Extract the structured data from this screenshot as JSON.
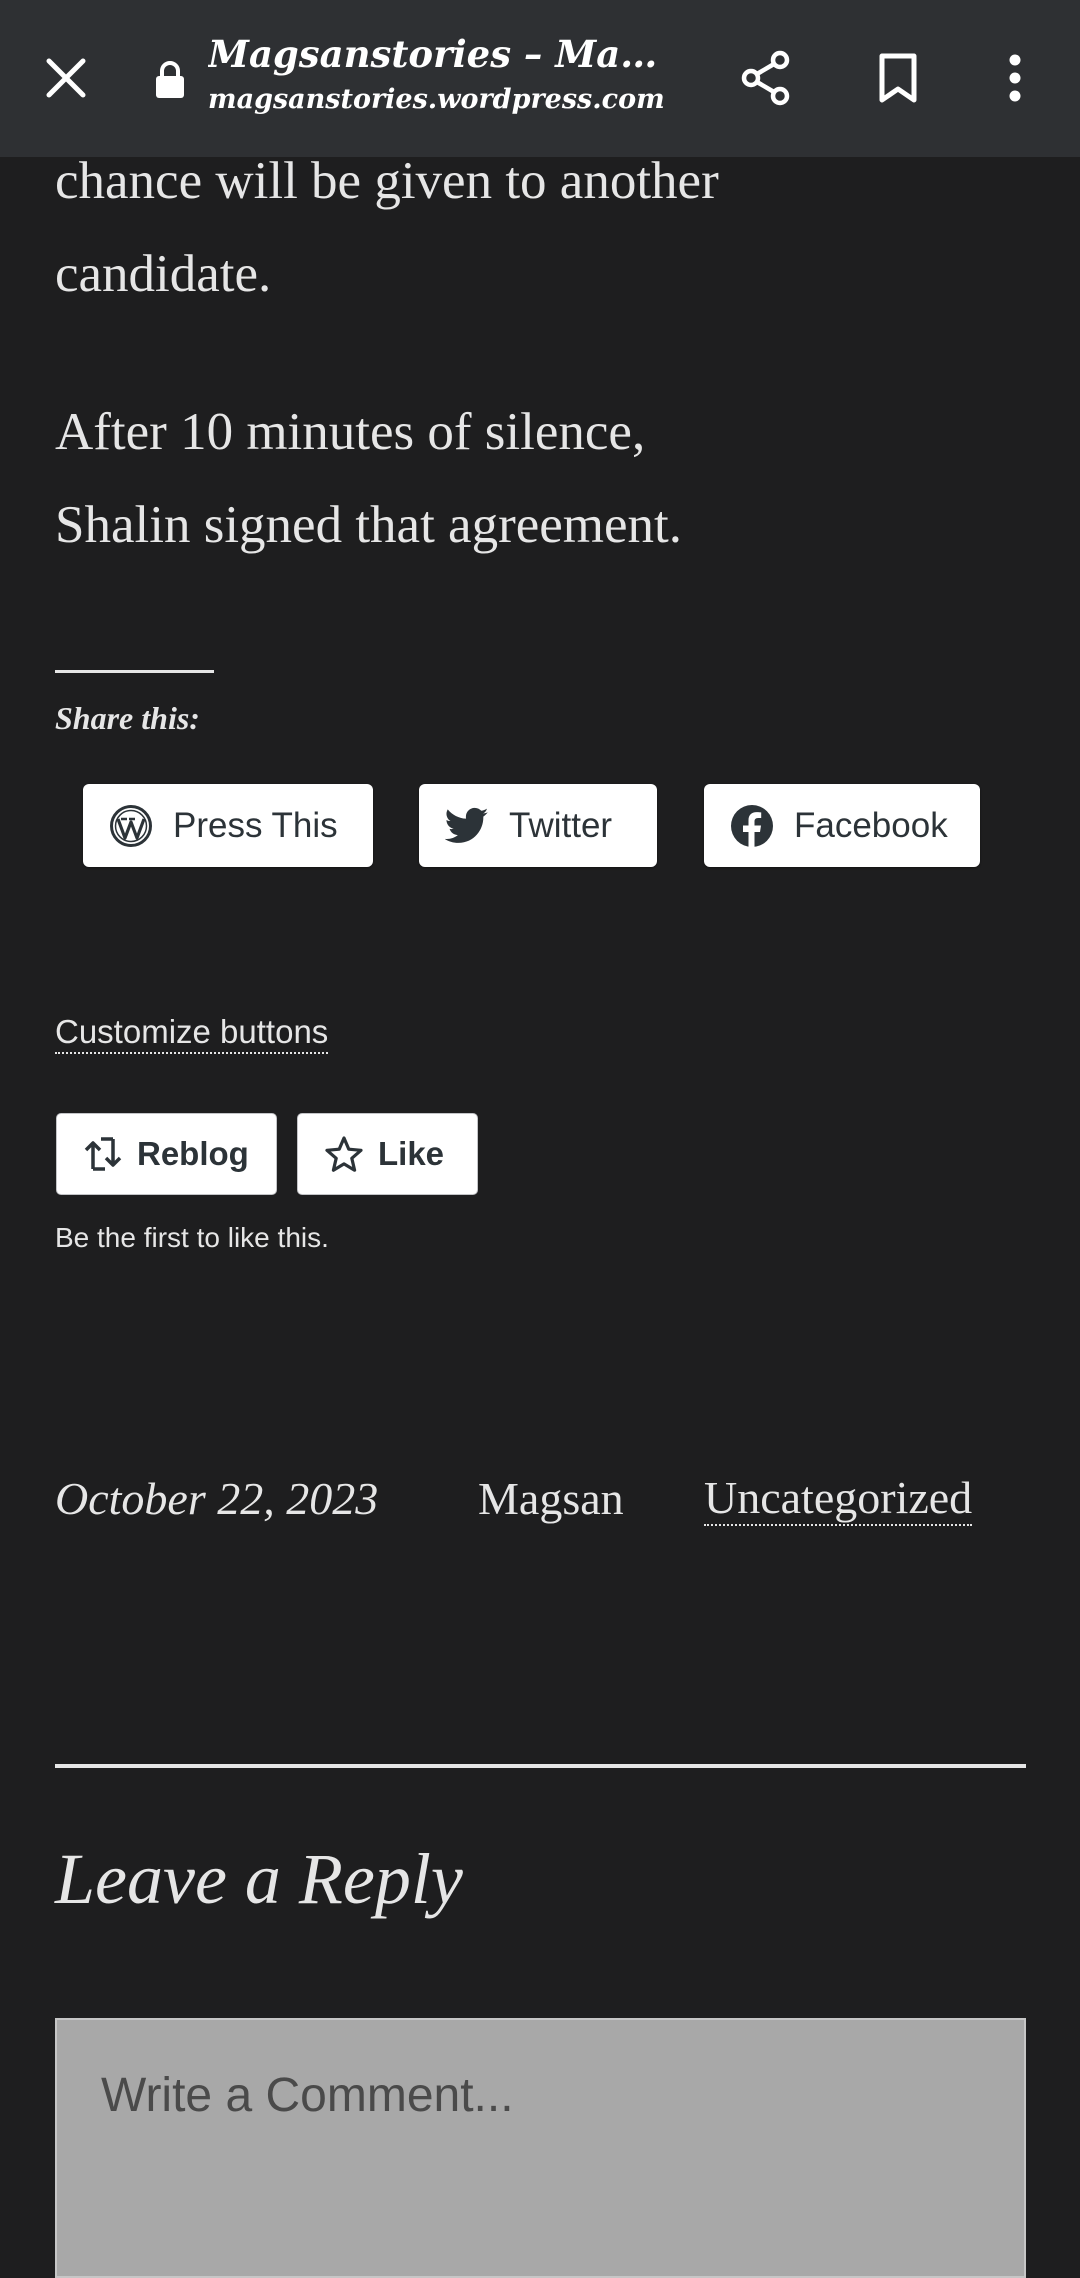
{
  "browser": {
    "title": "Magsanstories – Magsa…",
    "url": "magsanstories.wordpress.com",
    "icons": {
      "close": "close-icon",
      "lock": "lock-icon",
      "share": "share-icon",
      "bookmark": "bookmark-icon",
      "more": "more-vert-icon"
    }
  },
  "article": {
    "paragraph_1": "chance will be given to another\ncandidate.",
    "paragraph_2": "After 10 minutes of silence,\nShalin signed that agreement."
  },
  "sharing": {
    "heading": "Share this:",
    "buttons": [
      {
        "label": "Press This",
        "icon": "wordpress-icon"
      },
      {
        "label": "Twitter",
        "icon": "twitter-icon"
      },
      {
        "label": "Facebook",
        "icon": "facebook-icon"
      }
    ],
    "customize_link": "Customize buttons"
  },
  "likes": {
    "reblog_label": "Reblog",
    "like_label": "Like",
    "note": "Be the first to like this."
  },
  "post_meta": {
    "date": "October 22, 2023",
    "author": "Magsan",
    "category": "Uncategorized"
  },
  "reply": {
    "heading": "Leave a Reply",
    "comment_placeholder": "Write a Comment..."
  },
  "colors": {
    "background": "#1e1e1f",
    "topbar": "#2e3033",
    "text": "#e6e6e6",
    "button_bg": "#ffffff",
    "comment_box": "#a8a8a8"
  }
}
